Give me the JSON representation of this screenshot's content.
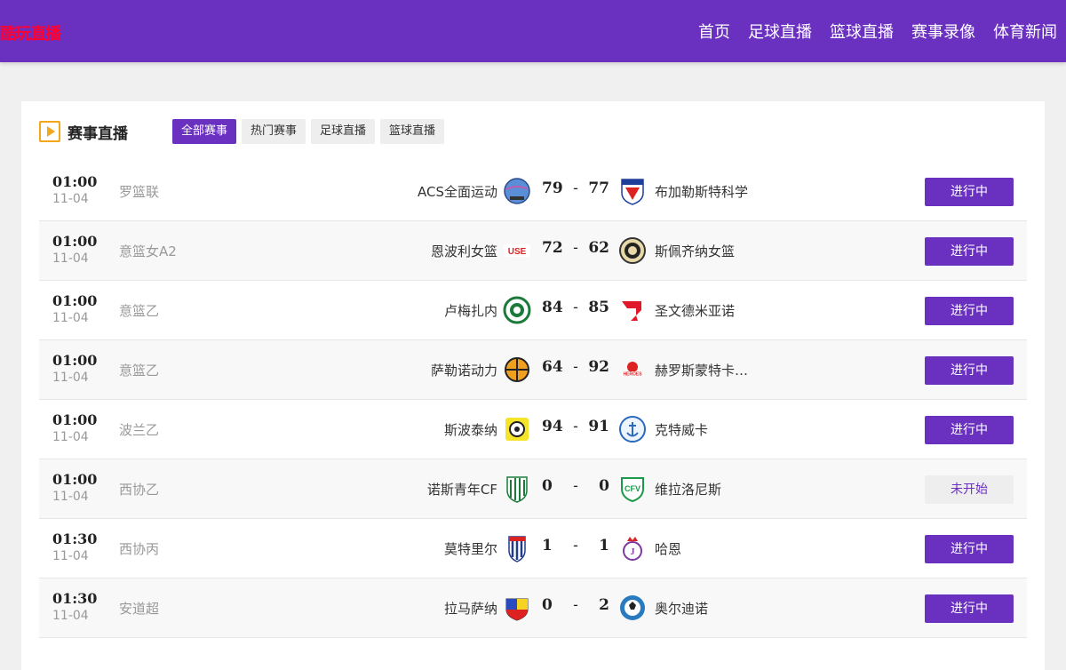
{
  "site": {
    "logo": "酷玩直播"
  },
  "nav": [
    "首页",
    "足球直播",
    "篮球直播",
    "赛事录像",
    "体育新闻"
  ],
  "section": {
    "title": "赛事直播",
    "tabs": [
      "全部赛事",
      "热门赛事",
      "足球直播",
      "篮球直播"
    ],
    "active_tab": "全部赛事"
  },
  "colors": {
    "brand": "#6a30c0",
    "logo_text": "#ff0033",
    "icon_accent": "#f2a71c"
  },
  "matches": [
    {
      "time": "01:00",
      "date": "11-04",
      "league": "罗篮联",
      "home": "ACS全面运动",
      "home_score": "79",
      "away_score": "77",
      "away": "布加勒斯特科学",
      "status": "进行中",
      "home_logo": "ball-crest",
      "away_logo": "shield-crest"
    },
    {
      "time": "01:00",
      "date": "11-04",
      "league": "意篮女A2",
      "home": "恩波利女篮",
      "home_score": "72",
      "away_score": "62",
      "away": "斯佩齐纳女篮",
      "status": "进行中",
      "home_logo": "use-text-crest",
      "away_logo": "round-crest"
    },
    {
      "time": "01:00",
      "date": "11-04",
      "league": "意篮乙",
      "home": "卢梅扎内",
      "home_score": "84",
      "away_score": "85",
      "away": "圣文德米亚诺",
      "status": "进行中",
      "home_logo": "green-round-crest",
      "away_logo": "red-arrow-crest"
    },
    {
      "time": "01:00",
      "date": "11-04",
      "league": "意篮乙",
      "home": "萨勒诺动力",
      "home_score": "64",
      "away_score": "92",
      "away": "赫罗斯蒙特卡…",
      "status": "进行中",
      "home_logo": "orange-ball-crest",
      "away_logo": "heroes-crest"
    },
    {
      "time": "01:00",
      "date": "11-04",
      "league": "波兰乙",
      "home": "斯波泰纳",
      "home_score": "94",
      "away_score": "91",
      "away": "克特威卡",
      "status": "进行中",
      "home_logo": "yellow-crest",
      "away_logo": "anchor-crest"
    },
    {
      "time": "01:00",
      "date": "11-04",
      "league": "西协乙",
      "home": "诺斯青年CF",
      "home_score": "0",
      "away_score": "0",
      "away": "维拉洛尼斯",
      "status": "未开始",
      "home_logo": "green-stripe-crest",
      "away_logo": "cfv-crest"
    },
    {
      "time": "01:30",
      "date": "11-04",
      "league": "西协丙",
      "home": "莫特里尔",
      "home_score": "1",
      "away_score": "1",
      "away": "哈恩",
      "status": "进行中",
      "home_logo": "blue-stripe-crest",
      "away_logo": "crown-crest"
    },
    {
      "time": "01:30",
      "date": "11-04",
      "league": "安道超",
      "home": "拉马萨纳",
      "home_score": "0",
      "away_score": "2",
      "away": "奥尔迪诺",
      "status": "进行中",
      "home_logo": "flag-crest",
      "away_logo": "blue-ball-crest"
    }
  ]
}
